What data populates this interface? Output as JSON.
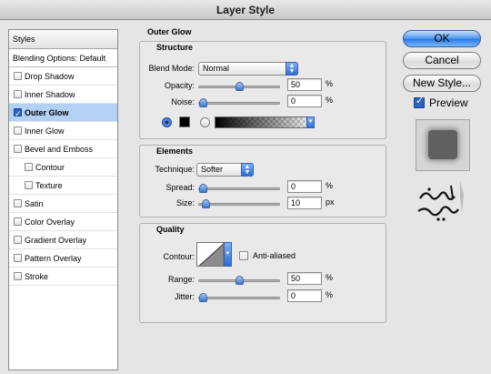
{
  "window": {
    "title": "Layer Style"
  },
  "styles_panel": {
    "header": "Styles",
    "blend_options_item": "Blending Options: Default",
    "items": [
      {
        "label": "Drop Shadow",
        "checked": false,
        "selected": false,
        "sub": false
      },
      {
        "label": "Inner Shadow",
        "checked": false,
        "selected": false,
        "sub": false
      },
      {
        "label": "Outer Glow",
        "checked": true,
        "selected": true,
        "sub": false
      },
      {
        "label": "Inner Glow",
        "checked": false,
        "selected": false,
        "sub": false
      },
      {
        "label": "Bevel and Emboss",
        "checked": false,
        "selected": false,
        "sub": false
      },
      {
        "label": "Contour",
        "checked": false,
        "selected": false,
        "sub": true
      },
      {
        "label": "Texture",
        "checked": false,
        "selected": false,
        "sub": true
      },
      {
        "label": "Satin",
        "checked": false,
        "selected": false,
        "sub": false
      },
      {
        "label": "Color Overlay",
        "checked": false,
        "selected": false,
        "sub": false
      },
      {
        "label": "Gradient Overlay",
        "checked": false,
        "selected": false,
        "sub": false
      },
      {
        "label": "Pattern Overlay",
        "checked": false,
        "selected": false,
        "sub": false
      },
      {
        "label": "Stroke",
        "checked": false,
        "selected": false,
        "sub": false
      }
    ]
  },
  "outer_glow": {
    "title": "Outer Glow",
    "structure": {
      "title": "Structure",
      "blend_mode_label": "Blend Mode:",
      "blend_mode_value": "Normal",
      "opacity_label": "Opacity:",
      "opacity_value": "50",
      "opacity_fraction": 0.5,
      "opacity_unit": "%",
      "noise_label": "Noise:",
      "noise_value": "0",
      "noise_fraction": 0,
      "noise_unit": "%",
      "color_mode": "solid",
      "color": "#000000"
    },
    "elements": {
      "title": "Elements",
      "technique_label": "Technique:",
      "technique_value": "Softer",
      "spread_label": "Spread:",
      "spread_value": "0",
      "spread_fraction": 0,
      "spread_unit": "%",
      "size_label": "Size:",
      "size_value": "10",
      "size_fraction": 0.04,
      "size_unit": "px"
    },
    "quality": {
      "title": "Quality",
      "contour_label": "Contour:",
      "anti_aliased_label": "Anti-aliased",
      "anti_aliased_checked": false,
      "range_label": "Range:",
      "range_value": "50",
      "range_fraction": 0.5,
      "range_unit": "%",
      "jitter_label": "Jitter:",
      "jitter_value": "0",
      "jitter_fraction": 0,
      "jitter_unit": "%"
    }
  },
  "buttons": {
    "ok": "OK",
    "cancel": "Cancel",
    "new_style": "New Style...",
    "preview_label": "Preview",
    "preview_checked": true
  },
  "colors": {
    "accent": "#2c7ae6",
    "selection": "#b3d1f4",
    "preview_swatch": "#606060"
  }
}
